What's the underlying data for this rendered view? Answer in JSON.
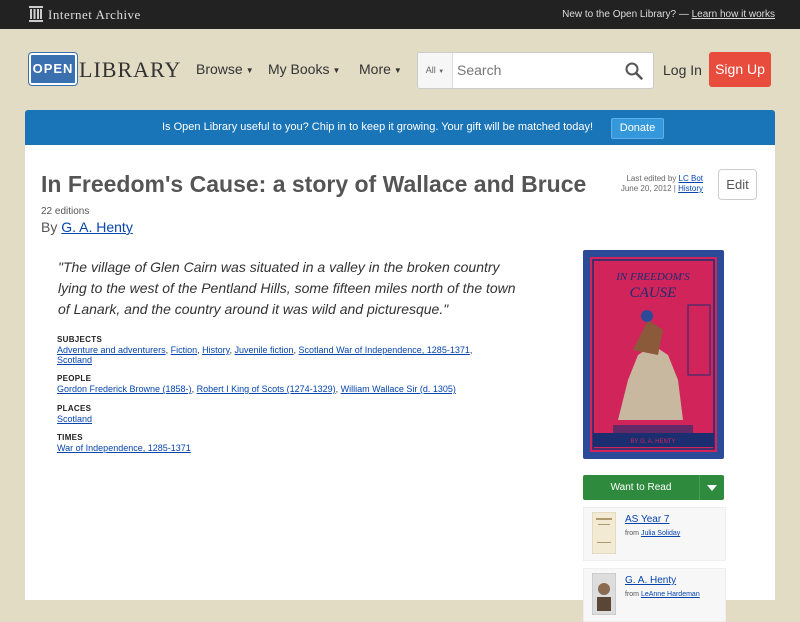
{
  "topbar": {
    "site_name": "Internet Archive",
    "promo_text": "New to the Open Library? —",
    "promo_link": "Learn how it works"
  },
  "header": {
    "logo_badge": "OPEN",
    "logo_text": "LIBRARY",
    "nav": [
      {
        "label": "Browse"
      },
      {
        "label": "My Books"
      },
      {
        "label": "More"
      }
    ],
    "search": {
      "scope": "All",
      "placeholder": "Search"
    },
    "login_label": "Log In",
    "signup_label": "Sign Up"
  },
  "banner": {
    "text": "Is Open Library useful to you? Chip in to keep it growing. Your gift will be matched today!",
    "button": "Donate"
  },
  "work": {
    "title": "In Freedom's Cause: a story of Wallace and Bruce",
    "editions": "22 editions",
    "by_prefix": "By",
    "author": "G. A. Henty",
    "last_edited_prefix": "Last edited by",
    "last_edited_by": "LC Bot",
    "last_edited_date": "June 20, 2012 |",
    "history_link": "History",
    "edit_label": "Edit",
    "quote": "\"The village of Glen Cairn was situated in a valley in the broken country lying to the west of the Pentland Hills, some fifteen miles north of the town of Lanark, and the country around it was wild and picturesque.\"",
    "subjects_heading": "SUBJECTS",
    "subjects": [
      "Adventure and adventurers",
      "Fiction",
      "History",
      "Juvenile fiction",
      "Scotland War of Independence, 1285-1371",
      "Scotland"
    ],
    "people_heading": "PEOPLE",
    "people": [
      "Gordon Frederick Browne (1858-)",
      "Robert I King of Scots (1274-1329)",
      "William Wallace Sir (d. 1305)"
    ],
    "places_heading": "PLACES",
    "places": [
      "Scotland"
    ],
    "times_heading": "TIMES",
    "times": [
      "War of Independence, 1285-1371"
    ]
  },
  "cover": {
    "title_line1": "IN FREEDOM'S",
    "title_line2": "CAUSE",
    "author": "BY G. A. HENTY"
  },
  "want_to_read": {
    "label": "Want to Read"
  },
  "lists": [
    {
      "title": "AS Year 7",
      "from_prefix": "from",
      "user": "Julia Soliday"
    },
    {
      "title": "G. A. Henty",
      "from_prefix": "from",
      "user": "LeAnne Hardeman"
    }
  ],
  "colors": {
    "accent": "#1974b8",
    "signup": "#e74c3c",
    "want_to_read": "#2e8b3e",
    "cover": "#2b4a98",
    "cover_inner": "#d1245a"
  }
}
